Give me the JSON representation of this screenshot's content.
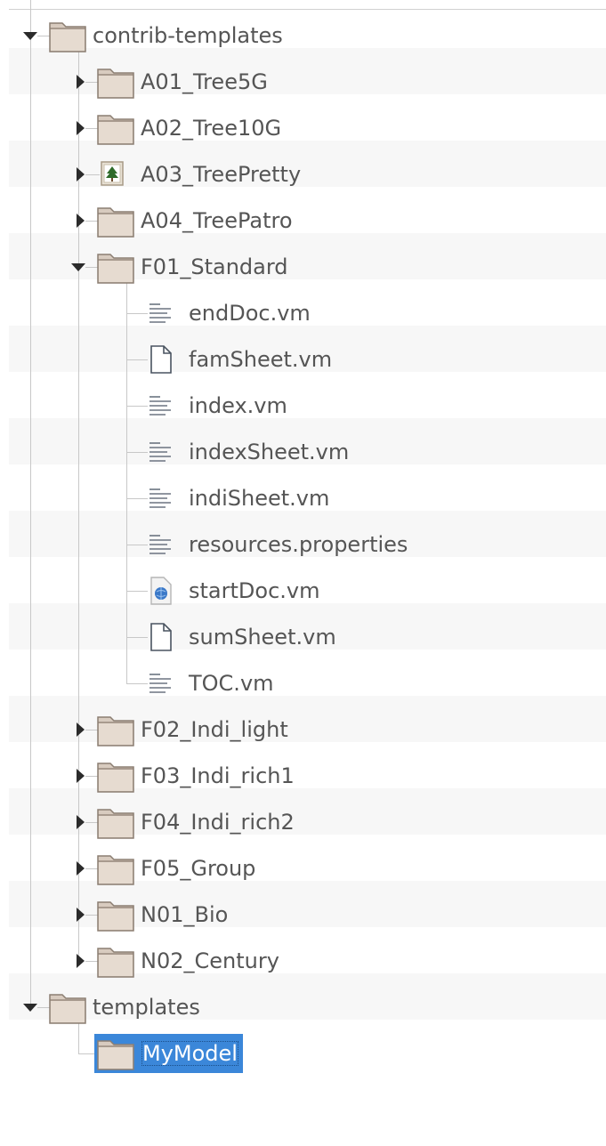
{
  "tree": {
    "nodes": [
      {
        "label": "contrib-templates",
        "icon": "folder-icon",
        "depth": 0,
        "expander": "expanded"
      },
      {
        "label": "A01_Tree5G",
        "icon": "folder-icon",
        "depth": 1,
        "expander": "collapsed"
      },
      {
        "label": "A02_Tree10G",
        "icon": "folder-icon",
        "depth": 1,
        "expander": "collapsed"
      },
      {
        "label": "A03_TreePretty",
        "icon": "tree-image-icon",
        "depth": 1,
        "expander": "collapsed"
      },
      {
        "label": "A04_TreePatro",
        "icon": "folder-icon",
        "depth": 1,
        "expander": "collapsed"
      },
      {
        "label": "F01_Standard",
        "icon": "folder-icon",
        "depth": 1,
        "expander": "expanded"
      },
      {
        "label": "endDoc.vm",
        "icon": "text-file-icon",
        "depth": 2,
        "expander": "none"
      },
      {
        "label": "famSheet.vm",
        "icon": "blank-file-icon",
        "depth": 2,
        "expander": "none"
      },
      {
        "label": "index.vm",
        "icon": "text-file-icon",
        "depth": 2,
        "expander": "none"
      },
      {
        "label": "indexSheet.vm",
        "icon": "text-file-icon",
        "depth": 2,
        "expander": "none"
      },
      {
        "label": "indiSheet.vm",
        "icon": "text-file-icon",
        "depth": 2,
        "expander": "none"
      },
      {
        "label": "resources.properties",
        "icon": "text-file-icon",
        "depth": 2,
        "expander": "none"
      },
      {
        "label": "startDoc.vm",
        "icon": "web-file-icon",
        "depth": 2,
        "expander": "none"
      },
      {
        "label": "sumSheet.vm",
        "icon": "blank-file-icon",
        "depth": 2,
        "expander": "none"
      },
      {
        "label": "TOC.vm",
        "icon": "text-file-icon",
        "depth": 2,
        "expander": "none"
      },
      {
        "label": "F02_Indi_light",
        "icon": "folder-icon",
        "depth": 1,
        "expander": "collapsed"
      },
      {
        "label": "F03_Indi_rich1",
        "icon": "folder-icon",
        "depth": 1,
        "expander": "collapsed"
      },
      {
        "label": "F04_Indi_rich2",
        "icon": "folder-icon",
        "depth": 1,
        "expander": "collapsed"
      },
      {
        "label": "F05_Group",
        "icon": "folder-icon",
        "depth": 1,
        "expander": "collapsed"
      },
      {
        "label": "N01_Bio",
        "icon": "folder-icon",
        "depth": 1,
        "expander": "collapsed"
      },
      {
        "label": "N02_Century",
        "icon": "folder-icon",
        "depth": 1,
        "expander": "collapsed"
      },
      {
        "label": "templates",
        "icon": "folder-icon",
        "depth": 0,
        "expander": "expanded"
      },
      {
        "label": "MyModel",
        "icon": "folder-icon",
        "depth": 1,
        "expander": "none",
        "selected": true
      }
    ]
  },
  "colors": {
    "selection": "#3b87d9",
    "label_text": "#555555",
    "stripe": "#f7f7f7",
    "folder_fill": "#d8cbbf",
    "folder_stroke": "#8b7e72"
  }
}
